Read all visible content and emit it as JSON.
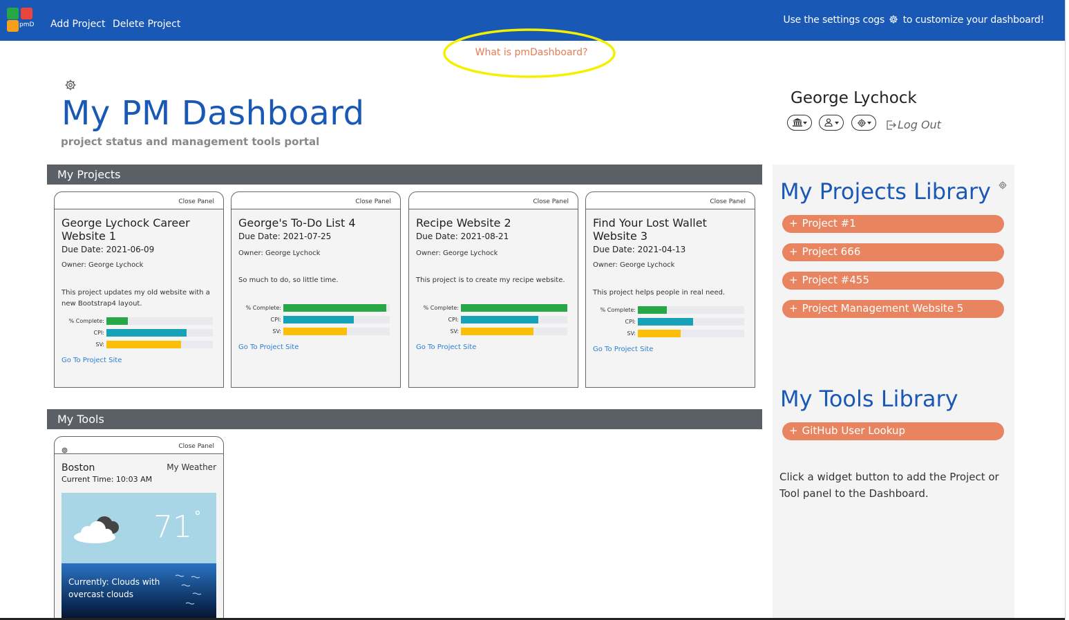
{
  "topbar": {
    "logo_text": "pmD",
    "add_project": "Add Project",
    "delete_project": "Delete Project",
    "hint_before": "Use the settings cogs",
    "hint_after": "to customize your dashboard!",
    "background": "#1a58b6"
  },
  "whatis": "What is pmDashboard?",
  "header": {
    "title": "My PM Dashboard",
    "subtitle": "project status and management tools portal"
  },
  "user": {
    "name": "George Lychock",
    "logout": "Log Out"
  },
  "sections": {
    "projects": "My Projects",
    "tools": "My Tools"
  },
  "projects": [
    {
      "close": "Close Panel",
      "title": "George Lychock Career Website 1",
      "due": "Due Date: 2021-06-09",
      "owner": "Owner: George Lychock",
      "description": "This project updates my old website with a new Bootstrap4 layout.",
      "complete_label": "% Complete:",
      "cpi_label": "CPI:",
      "sv_label": "SV:",
      "complete": 0.2,
      "cpi": 0.75,
      "sv": 0.7,
      "link": "Go To Project Site"
    },
    {
      "close": "Close Panel",
      "title": "George's To-Do List 4",
      "due": "Due Date: 2021-07-25",
      "owner": "Owner: George Lychock",
      "description": "So much to do, so little time.",
      "complete_label": "% Complete:",
      "cpi_label": "CPI:",
      "sv_label": "SV:",
      "complete": 0.97,
      "cpi": 0.66,
      "sv": 0.6,
      "link": "Go To Project Site"
    },
    {
      "close": "Close Panel",
      "title": "Recipe Website 2",
      "due": "Due Date: 2021-08-21",
      "owner": "Owner: George Lychock",
      "description": "This project is to create my recipe website.",
      "complete_label": "% Complete:",
      "cpi_label": "CPI:",
      "sv_label": "SV:",
      "complete": 1.0,
      "cpi": 0.73,
      "sv": 0.68,
      "link": "Go To Project Site"
    },
    {
      "close": "Close Panel",
      "title": "Find Your Lost Wallet Website 3",
      "due": "Due Date: 2021-04-13",
      "owner": "Owner: George Lychock",
      "description": "This project helps people in real need.",
      "complete_label": "% Complete:",
      "cpi_label": "CPI:",
      "sv_label": "SV:",
      "complete": 0.27,
      "cpi": 0.52,
      "sv": 0.4,
      "link": "Go To Project Site"
    }
  ],
  "weather": {
    "close": "Close Panel",
    "city": "Boston",
    "label": "My Weather",
    "time": "Current Time: 10:03 AM",
    "temp": "71",
    "degree": "°",
    "condition": "Currently: Clouds with overcast clouds"
  },
  "library": {
    "projects_title": "My Projects Library",
    "projects": [
      "Project #1",
      "Project 666",
      "Project #455",
      "Project Management Website 5"
    ],
    "tools_title": "My Tools Library",
    "tools": [
      "GitHub User Lookup"
    ],
    "plus": "+",
    "note": "Click a widget button to add the Project or Tool panel to the Dashboard.",
    "button_color": "#e8845f"
  }
}
